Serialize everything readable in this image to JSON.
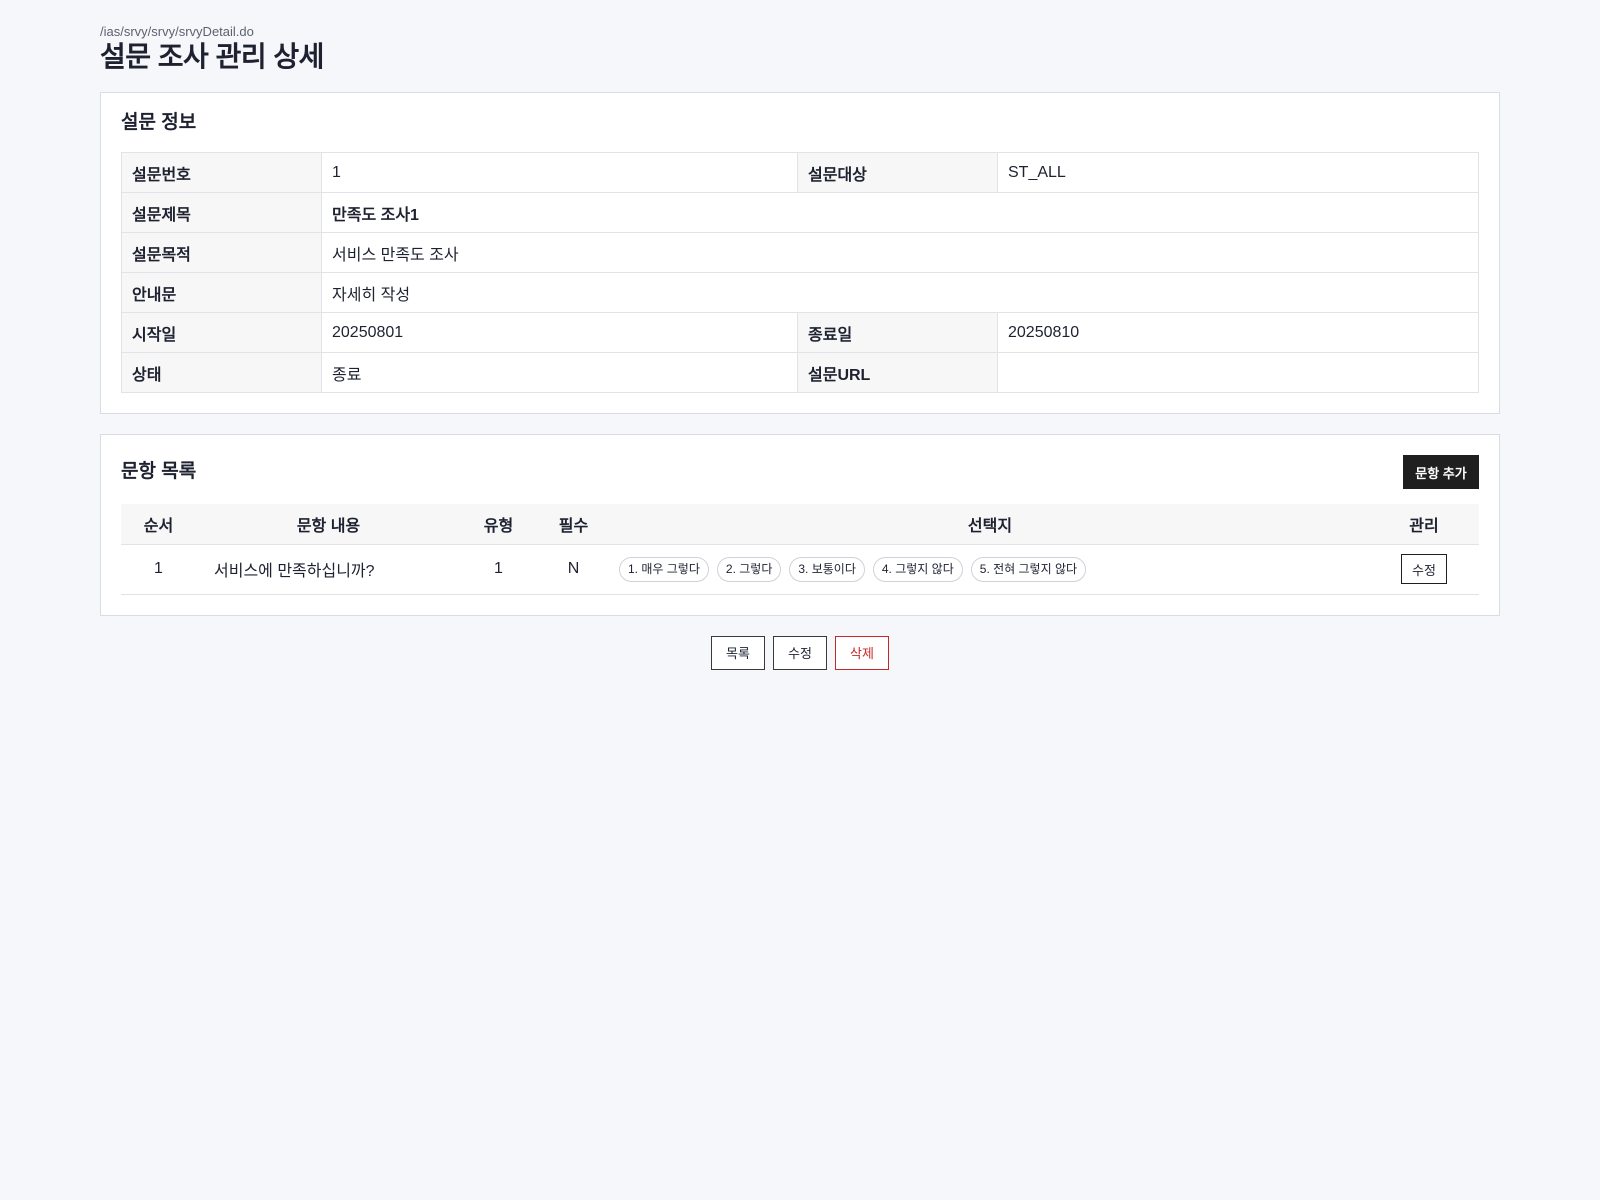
{
  "header": {
    "path": "/ias/srvy/srvy/srvyDetail.do",
    "title": "설문 조사 관리 상세"
  },
  "info": {
    "title": "설문 정보",
    "labels": {
      "no": "설문번호",
      "target": "설문대상",
      "subject": "설문제목",
      "purpose": "설문목적",
      "guide": "안내문",
      "start": "시작일",
      "end": "종료일",
      "status": "상태",
      "url": "설문URL"
    },
    "values": {
      "no": "1",
      "target": "ST_ALL",
      "subject": "만족도 조사1",
      "purpose": "서비스 만족도 조사",
      "guide": "자세히 작성",
      "start": "20250801",
      "end": "20250810",
      "status": "종료",
      "url": ""
    }
  },
  "items": {
    "title": "문항 목록",
    "add_label": "문항 추가",
    "columns": {
      "order": "순서",
      "content": "문항 내용",
      "type": "유형",
      "required": "필수",
      "choices": "선택지",
      "manage": "관리"
    },
    "rows": [
      {
        "order": "1",
        "content": "서비스에 만족하십니까?",
        "type": "1",
        "required": "N",
        "choices": [
          "1. 매우 그렇다",
          "2. 그렇다",
          "3. 보통이다",
          "4. 그렇지 않다",
          "5. 전혀 그렇지 않다"
        ],
        "edit_label": "수정"
      }
    ]
  },
  "footer": {
    "list_label": "목록",
    "edit_label": "수정",
    "delete_label": "삭제"
  },
  "colors": {
    "danger": "#c62828",
    "dark_button": "#1f1f1f",
    "background": "#f6f7fb"
  }
}
